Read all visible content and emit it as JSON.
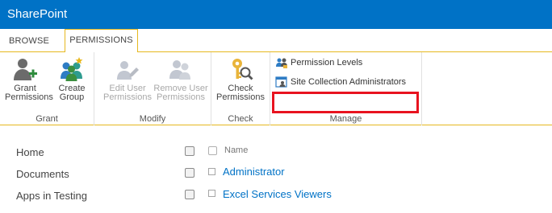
{
  "app": {
    "brand": "SharePoint"
  },
  "tabs": [
    {
      "label": "BROWSE",
      "active": false
    },
    {
      "label": "PERMISSIONS",
      "active": true
    }
  ],
  "ribbon": {
    "grant": {
      "label": "Grant",
      "grant_permissions": [
        "Grant",
        "Permissions"
      ],
      "create_group": [
        "Create",
        "Group"
      ]
    },
    "modify": {
      "label": "Modify",
      "edit_user_permissions": [
        "Edit User",
        "Permissions"
      ],
      "remove_user_permissions": [
        "Remove User",
        "Permissions"
      ]
    },
    "check": {
      "label": "Check",
      "check_permissions": [
        "Check",
        "Permissions"
      ]
    },
    "manage": {
      "label": "Manage",
      "permission_levels": "Permission Levels",
      "site_collection_administrators": "Site Collection Administrators"
    }
  },
  "quick_launch": [
    "Home",
    "Documents",
    "Apps in Testing"
  ],
  "list": {
    "column_name": "Name",
    "rows": [
      "Administrator",
      "Excel Services Viewers"
    ]
  },
  "colors": {
    "suite_bar": "#0072c6",
    "tab_accent": "#e6b81f",
    "highlight_box": "#e8131f",
    "link": "#0072c6"
  }
}
